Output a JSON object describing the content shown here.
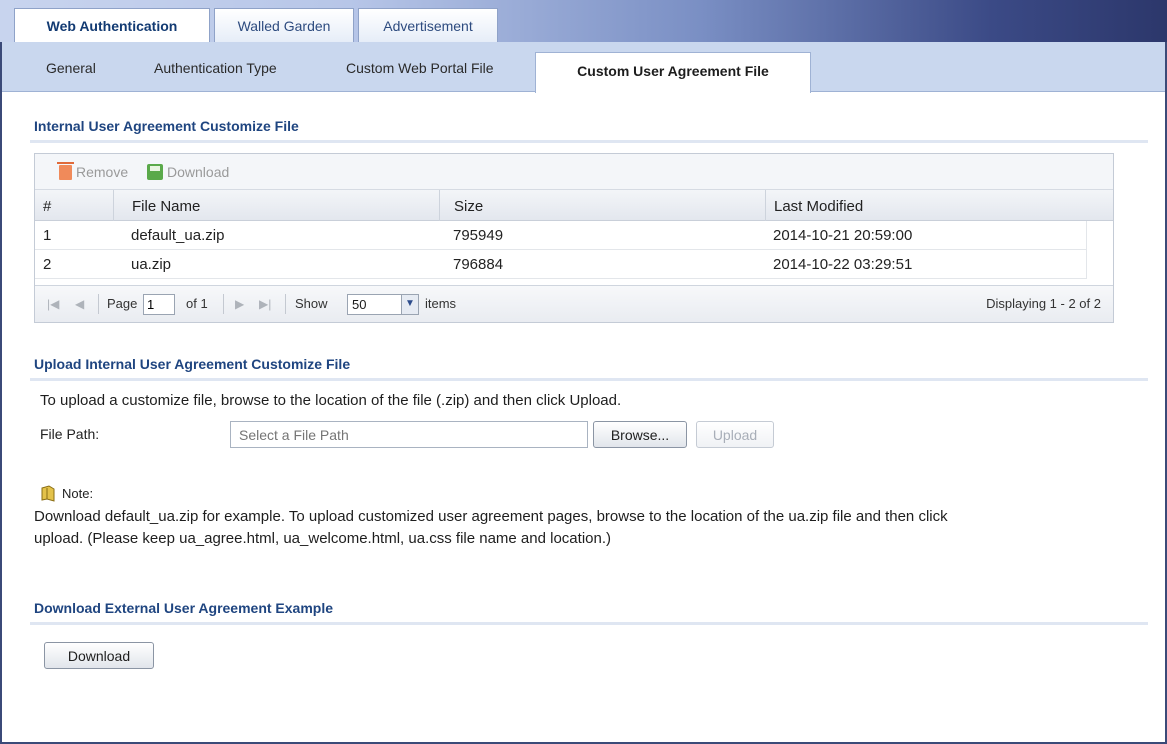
{
  "top_tabs": [
    {
      "label": "Web Authentication",
      "active": true
    },
    {
      "label": "Walled Garden",
      "active": false
    },
    {
      "label": "Advertisement",
      "active": false
    }
  ],
  "sub_tabs": [
    {
      "label": "General",
      "active": false
    },
    {
      "label": "Authentication Type",
      "active": false
    },
    {
      "label": "Custom Web Portal File",
      "active": false
    },
    {
      "label": "Custom User Agreement File",
      "active": true
    }
  ],
  "internal": {
    "title": "Internal User Agreement Customize File",
    "toolbar": {
      "remove_label": "Remove",
      "download_label": "Download"
    },
    "columns": [
      "#",
      "File Name",
      "Size",
      "Last Modified"
    ],
    "rows": [
      {
        "num": "1",
        "file": "default_ua.zip",
        "size": "795949",
        "modified": "2014-10-21 20:59:00"
      },
      {
        "num": "2",
        "file": "ua.zip",
        "size": "796884",
        "modified": "2014-10-22 03:29:51"
      }
    ],
    "pager": {
      "page_label": "Page",
      "page_value": "1",
      "of_label": "of 1",
      "show_label": "Show",
      "show_value": "50",
      "items_label": "items",
      "display_text": "Displaying 1 - 2 of 2"
    }
  },
  "upload": {
    "title": "Upload Internal User Agreement Customize File",
    "instruction": "To upload a customize file, browse to the location of the file (.zip) and then click Upload.",
    "file_path_label": "File Path:",
    "file_path_placeholder": "Select a File Path",
    "browse_label": "Browse...",
    "upload_label": "Upload",
    "note_label": "Note:",
    "note_line1": "Download default_ua.zip for example. To upload customized user agreement pages, browse to the location of the ua.zip file and then click",
    "note_line2": "upload. (Please keep ua_agree.html, ua_welcome.html, ua.css file name and location.)"
  },
  "external": {
    "title": "Download External User Agreement Example",
    "download_label": "Download"
  },
  "colors": {
    "accent": "#1f4580",
    "tab_bar": "#c9d7ee",
    "header_dark": "#2c376b"
  }
}
